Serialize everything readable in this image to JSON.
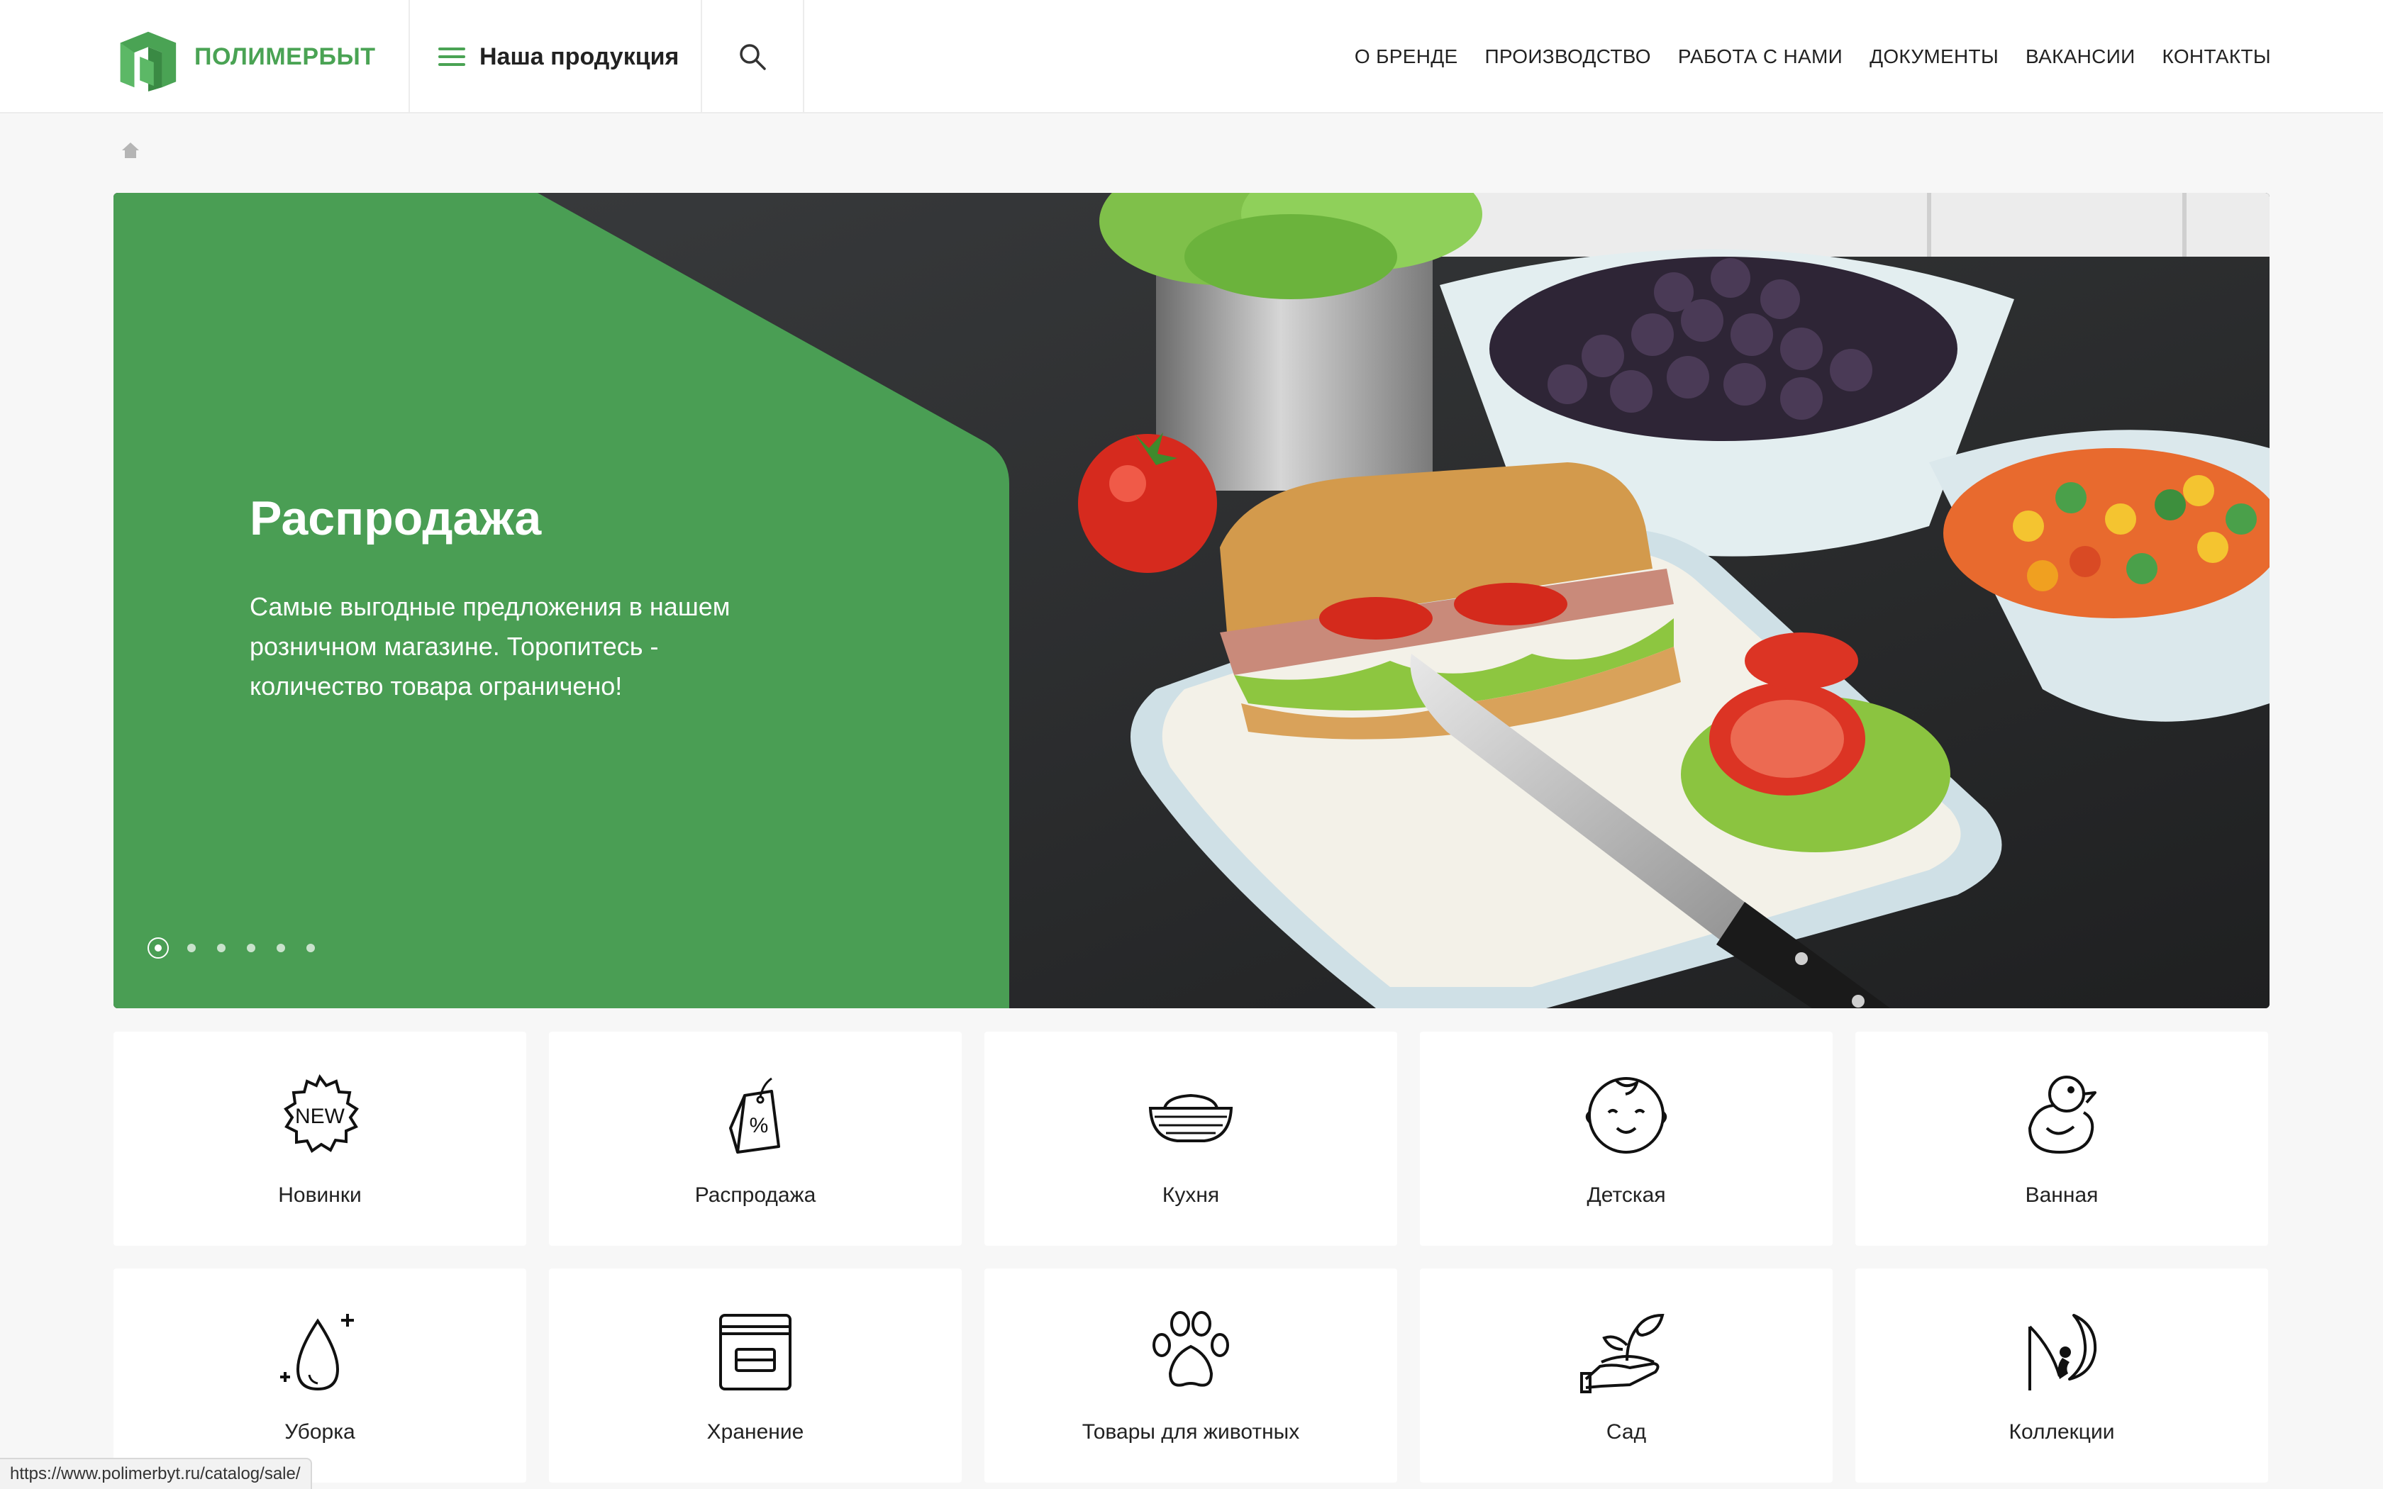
{
  "header": {
    "brand": "ПОЛИМЕРБЫТ",
    "brand_color": "#4aa354",
    "products_label": "Наша продукция",
    "nav": [
      "О БРЕНДЕ",
      "ПРОИЗВОДСТВО",
      "РАБОТА С НАМИ",
      "ДОКУМЕНТЫ",
      "ВАКАНСИИ",
      "КОНТАКТЫ"
    ]
  },
  "hero": {
    "title": "Распродажа",
    "text": "Самые выгодные предложения в нашем розничном магазине. Торопитесь - количество товара ограничено!",
    "slides_count": 6,
    "active_slide": 1,
    "panel_color": "#4a9e54"
  },
  "categories": [
    {
      "label": "Новинки",
      "icon": "new-badge-icon"
    },
    {
      "label": "Распродажа",
      "icon": "sale-tag-icon"
    },
    {
      "label": "Кухня",
      "icon": "kitchen-bowl-icon"
    },
    {
      "label": "Детская",
      "icon": "baby-face-icon"
    },
    {
      "label": "Ванная",
      "icon": "rubber-duck-icon"
    },
    {
      "label": "Уборка",
      "icon": "water-drop-icon"
    },
    {
      "label": "Хранение",
      "icon": "storage-box-icon"
    },
    {
      "label": "Товары для животных",
      "icon": "paw-icon"
    },
    {
      "label": "Сад",
      "icon": "plant-hand-icon"
    },
    {
      "label": "Коллекции",
      "icon": "moon-collection-icon"
    }
  ],
  "status_bar": {
    "url": "https://www.polimerbyt.ru/catalog/sale/"
  }
}
